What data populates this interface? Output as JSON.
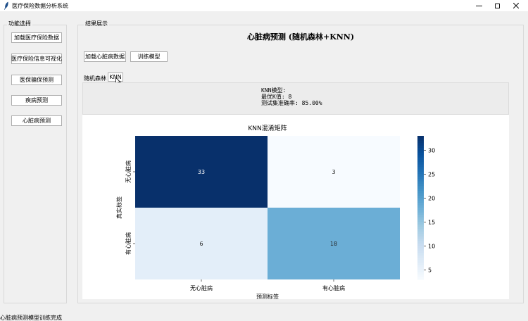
{
  "window": {
    "title": "医疗保险数据分析系统",
    "controls": {
      "minimize": "—",
      "maximize": "□",
      "close": "✕"
    }
  },
  "left_panel": {
    "title": "功能选择",
    "buttons": [
      "加载医疗保险数据",
      "医疗保险信息可视化",
      "医保骗保预测",
      "疾病预测",
      "心脏病预测"
    ]
  },
  "right_panel": {
    "title": "结果展示",
    "heading": "心脏病预测 (随机森林+KNN)",
    "load_button": "加载心脏病数据",
    "train_button": "训练模型",
    "model_tabs": {
      "label": "随机森林",
      "selected": "KNN"
    }
  },
  "model_info": {
    "lines": [
      "KNN模型:",
      "最优K值: 8",
      "测试集准确率: 85.00%"
    ]
  },
  "chart_data": {
    "type": "heatmap",
    "title": "KNN混淆矩阵",
    "xlabel": "预测标签",
    "ylabel": "真实标签",
    "x_categories": [
      "无心脏病",
      "有心脏病"
    ],
    "y_categories": [
      "无心脏病",
      "有心脏病"
    ],
    "values": [
      [
        33,
        3
      ],
      [
        6,
        18
      ]
    ],
    "colormap": "Blues",
    "colorbar": {
      "min": 3,
      "max": 33,
      "ticks": [
        5,
        10,
        15,
        20,
        25,
        30
      ]
    },
    "colors": {
      "low": "#f7fbff",
      "high": "#08306b"
    }
  },
  "status": "心脏病预测模型训练完成"
}
